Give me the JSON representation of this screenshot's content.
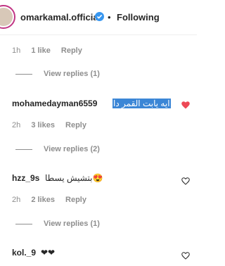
{
  "header": {
    "username": "omarkamal.official",
    "separator": "•",
    "follow_label": "Following"
  },
  "thread": {
    "meta1": {
      "time": "1h",
      "likes": "1 like",
      "reply": "Reply"
    },
    "view_replies_1": "View replies (1)",
    "comment1": {
      "user": "mohamedayman6559",
      "text": "ايه يابت القمر دا",
      "liked": true
    },
    "meta2": {
      "time": "2h",
      "likes": "3 likes",
      "reply": "Reply"
    },
    "view_replies_2": "View replies (2)",
    "comment2": {
      "user": "hzz_9s",
      "text": "بتشيش يسطا😍"
    },
    "meta3": {
      "time": "2h",
      "likes": "2 likes",
      "reply": "Reply"
    },
    "view_replies_3": "View replies (1)",
    "comment3": {
      "user": "kol._9",
      "text": "❤❤"
    }
  },
  "colors": {
    "verified": "#3897f0",
    "liked_heart": "#ed4956",
    "selection": "#3b86d6"
  },
  "icons": [
    "verified-badge-icon",
    "heart-filled-icon",
    "heart-outline-icon"
  ]
}
